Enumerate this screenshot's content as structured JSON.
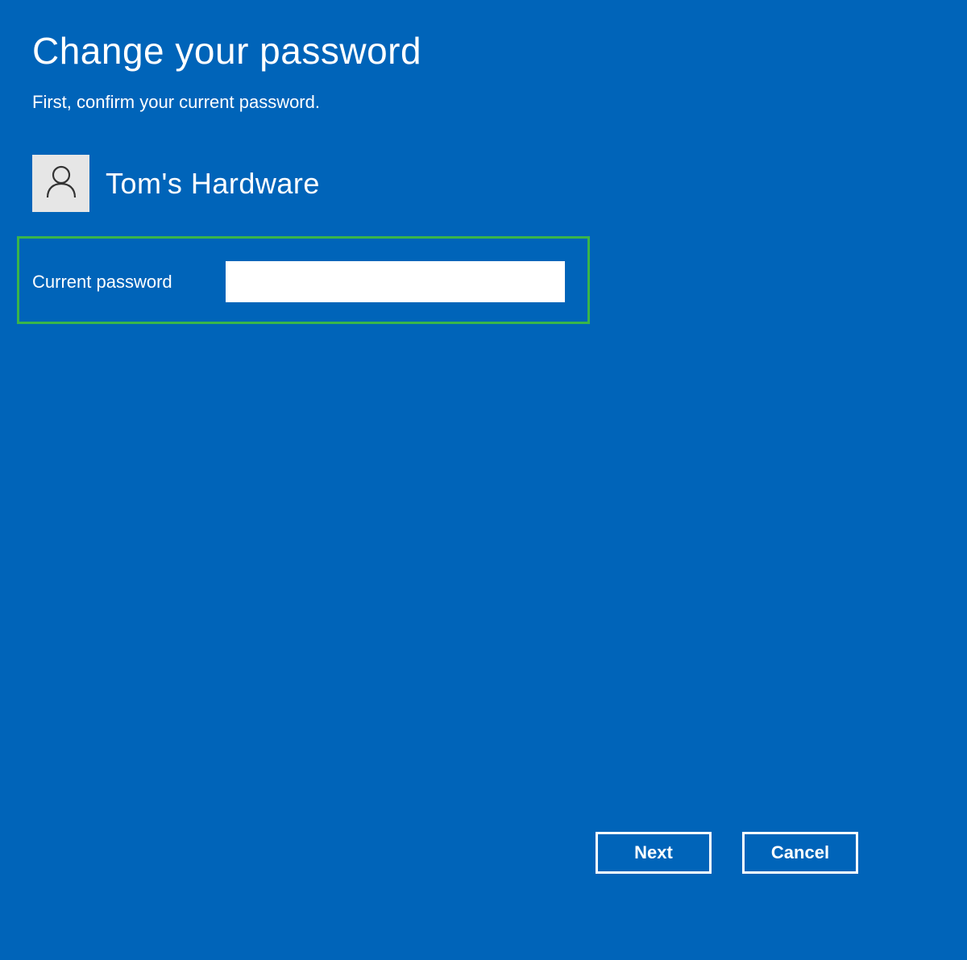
{
  "header": {
    "title": "Change your password",
    "subtitle": "First, confirm your current password."
  },
  "user": {
    "display_name": "Tom's Hardware"
  },
  "form": {
    "current_password_label": "Current password",
    "current_password_value": ""
  },
  "buttons": {
    "next": "Next",
    "cancel": "Cancel"
  },
  "colors": {
    "background": "#0064b9",
    "highlight_border": "#39b54a",
    "avatar_bg": "#e6e6e6"
  }
}
